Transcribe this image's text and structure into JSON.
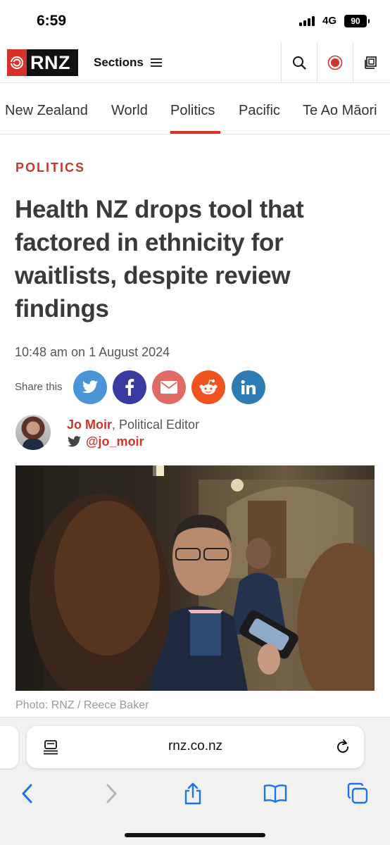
{
  "status": {
    "time": "6:59",
    "network": "4G",
    "battery": "90"
  },
  "header": {
    "logo_text": "RNZ",
    "sections_label": "Sections",
    "icons": [
      "menu-icon",
      "search-icon",
      "live-radio-icon",
      "rnz-player-icon"
    ],
    "accent_color": "#d4322a"
  },
  "nav": {
    "items": [
      {
        "label": "New Zealand"
      },
      {
        "label": "World"
      },
      {
        "label": "Politics",
        "active": true
      },
      {
        "label": "Pacific"
      },
      {
        "label": "Te Ao Māori"
      }
    ]
  },
  "article": {
    "category": "POLITICS",
    "headline": "Health NZ drops tool that factored in ethnicity for waitlists, despite review findings",
    "date": "10:48 am on 1 August 2024",
    "share_label": "Share this",
    "share_buttons": [
      {
        "name": "twitter",
        "color": "#4a95d6"
      },
      {
        "name": "facebook",
        "color": "#3a3b9e"
      },
      {
        "name": "email",
        "color": "#e16a63"
      },
      {
        "name": "reddit",
        "color": "#f0541e"
      },
      {
        "name": "linkedin",
        "color": "#2f7cb5"
      }
    ],
    "author": {
      "name": "Jo Moir",
      "role": ", Political Editor",
      "twitter_handle": "@jo_moir"
    },
    "photo_caption": "Photo: RNZ / Reece Baker"
  },
  "browser": {
    "url": "rnz.co.nz",
    "toolbar_icons": [
      "back-icon",
      "forward-icon",
      "share-icon",
      "bookmarks-icon",
      "tabs-icon"
    ]
  }
}
